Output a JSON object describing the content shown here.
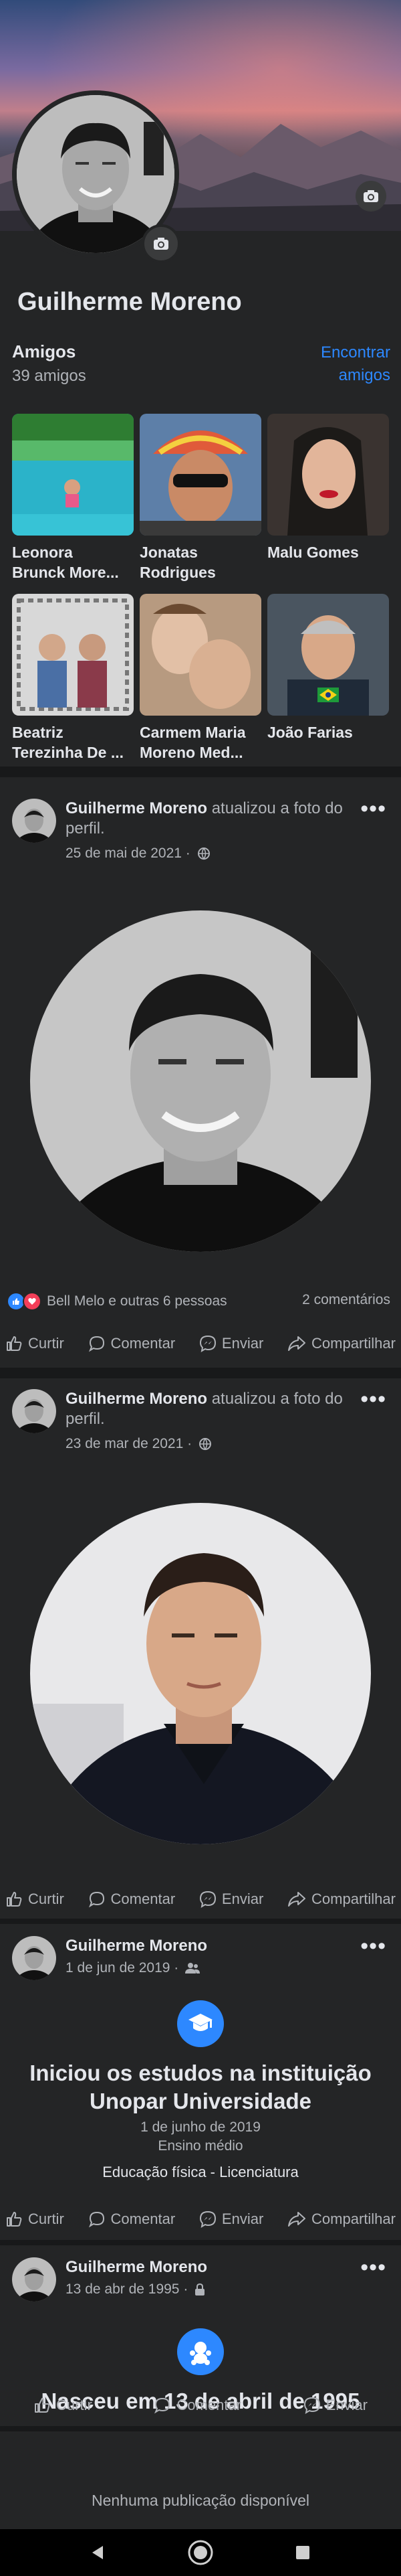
{
  "profile": {
    "name": "Guilherme Moreno"
  },
  "friends": {
    "title": "Amigos",
    "count": "39 amigos",
    "find_label": "Encontrar amigos",
    "items": [
      {
        "name": "Leonora\nBrunck More..."
      },
      {
        "name": "Jonatas\nRodrigues"
      },
      {
        "name": "Malu Gomes"
      },
      {
        "name": "Beatriz\nTerezinha De ..."
      },
      {
        "name": "Carmem Maria\nMoreno Med..."
      },
      {
        "name": "João Farias"
      }
    ]
  },
  "posts": [
    {
      "author": "Guilherme Moreno",
      "action": "atualizou a foto do perfil.",
      "date": "25 de mai de 2021 ·",
      "reactions": "Bell Melo e outras 6 pessoas",
      "comments": "2 comentários"
    },
    {
      "author": "Guilherme Moreno",
      "action": "atualizou a foto do perfil.",
      "date": "23 de mar de 2021 ·"
    },
    {
      "author": "Guilherme Moreno",
      "date": "1 de jun de 2019 ·",
      "event_title": "Iniciou os estudos na instituição Unopar Universidade",
      "event_date": "1 de junho de 2019",
      "event_level": "Ensino médio",
      "event_course": "Educação física - Licenciatura"
    },
    {
      "author": "Guilherme Moreno",
      "date": "13 de abr de 1995 ·",
      "event_title": "Nasceu em 13 de abril de 1995"
    }
  ],
  "actions": {
    "like": "Curtir",
    "comment": "Comentar",
    "send": "Enviar",
    "share": "Compartilhar"
  },
  "footer": {
    "no_posts": "Nenhuma publicação disponível"
  },
  "colors": {
    "accent": "#2d88ff",
    "background": "#242526",
    "separator": "#18191a"
  }
}
